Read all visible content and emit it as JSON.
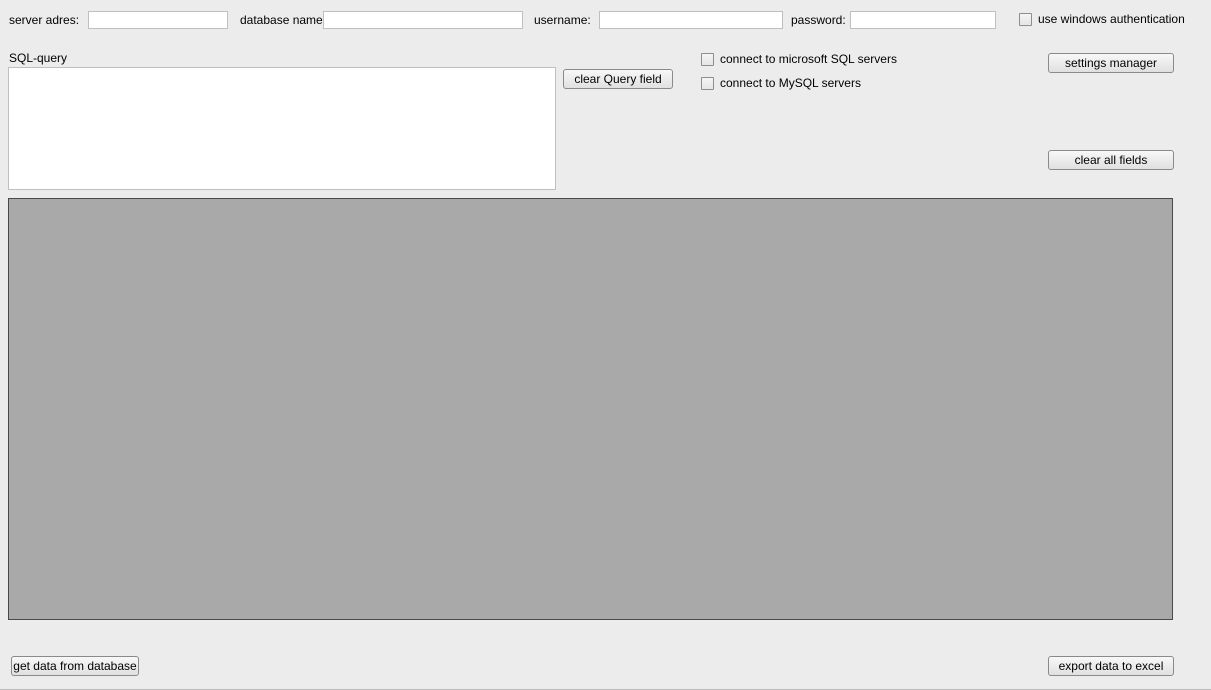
{
  "connection": {
    "server_label": "server adres:",
    "server_value": "",
    "db_label": "database name:",
    "db_value": "",
    "user_label": "username:",
    "user_value": "",
    "pass_label": "password:",
    "pass_value": "",
    "winauth_label": "use windows authentication",
    "winauth_checked": false
  },
  "query": {
    "label": "SQL-query",
    "value": "",
    "clear_label": "clear Query field"
  },
  "server_type": {
    "mssql_label": "connect to microsoft SQL servers",
    "mssql_checked": false,
    "mysql_label": "connect to MySQL servers",
    "mysql_checked": false
  },
  "buttons": {
    "settings_manager": "settings manager",
    "clear_all": "clear all fields",
    "get_data": "get data from database",
    "export_excel": "export data to excel"
  }
}
